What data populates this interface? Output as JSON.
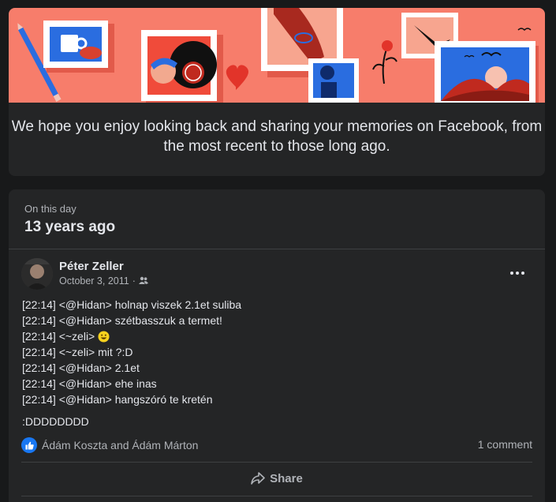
{
  "intro": {
    "message": "We hope you enjoy looking back and sharing your memories on Facebook, from the most recent to those long ago."
  },
  "memory": {
    "section_label": "On this day",
    "years_ago": "13 years ago",
    "post": {
      "author": "Péter Zeller",
      "date": "October 3, 2011",
      "separator": "·",
      "audience_icon": "friends-icon",
      "lines": [
        "[22:14] <@Hidan> holnap viszek 2.1et suliba",
        "[22:14] <@Hidan> szétbasszuk a termet!",
        "[22:14] <~zeli>",
        "[22:14] <~zeli> mit ?:D",
        "[22:14] <@Hidan> 2.1et",
        "[22:14] <@Hidan> ehe inas",
        "[22:14] <@Hidan> hangszóró te kretén"
      ],
      "tail": ":DDDDDDDD",
      "reactions": {
        "icon": "like-icon",
        "names": "Ádám Koszta and Ádám Márton"
      },
      "comments": "1 comment",
      "share_label": "Share"
    }
  },
  "colors": {
    "banner": "#f77d6b",
    "card_bg": "#242526",
    "page_bg": "#18191a",
    "like_blue": "#1877f2"
  }
}
